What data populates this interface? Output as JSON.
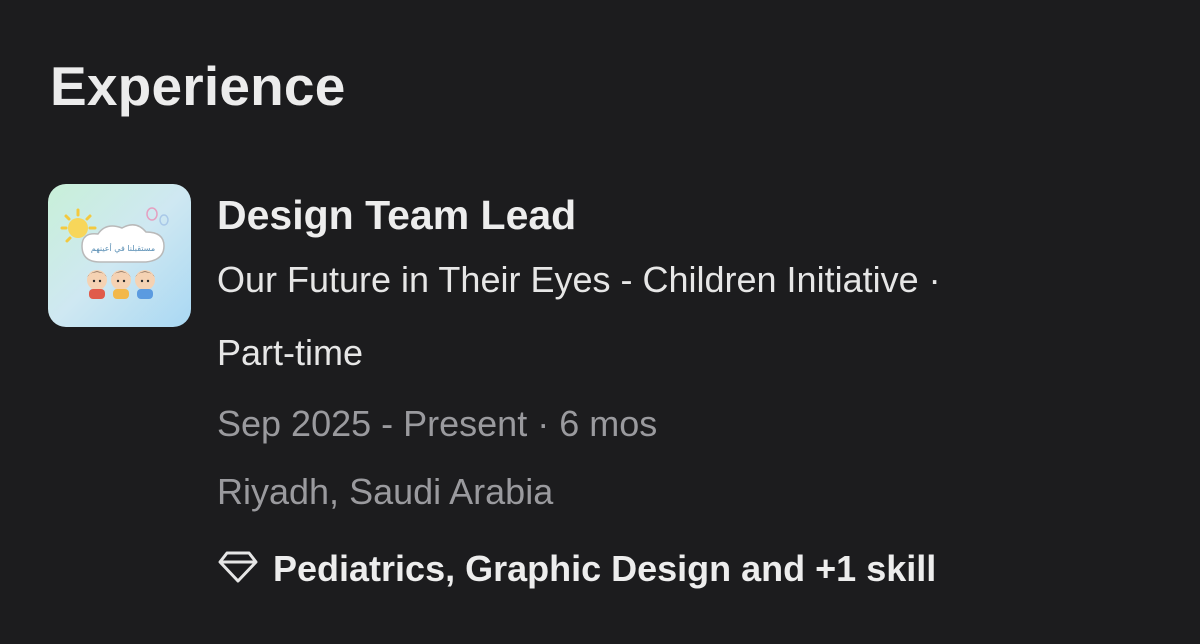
{
  "section": {
    "title": "Experience"
  },
  "experience": {
    "logo_text": "مستقبلنا في أعينهم",
    "job_title": "Design Team Lead",
    "company_line": "Our Future in Their Eyes - Children Initiative ·",
    "employment_type": "Part-time",
    "dates": "Sep 2025 - Present · 6 mos",
    "location": "Riyadh, Saudi Arabia",
    "skills_icon": "diamond-icon",
    "skills": "Pediatrics, Graphic Design and +1 skill"
  },
  "colors": {
    "background": "#1c1c1e",
    "primary_text": "#ececec",
    "secondary_text": "#9a9a9e"
  }
}
